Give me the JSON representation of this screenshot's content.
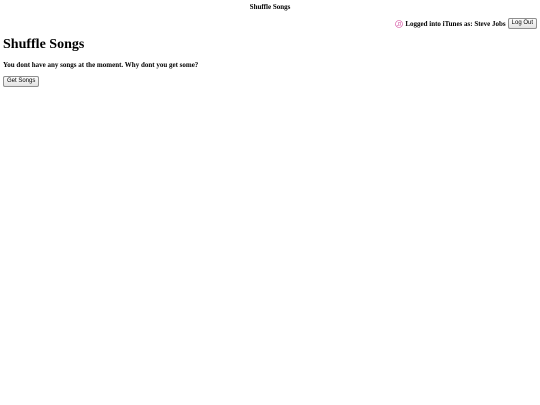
{
  "window": {
    "title": "Shuffle Songs"
  },
  "login": {
    "icon": "itunes-note-icon",
    "status_text": "Logged into iTunes as: Steve Jobs",
    "logout_label": "Log Out"
  },
  "main": {
    "heading": "Shuffle Songs",
    "empty_message": "You dont have any songs at the moment. Why dont you get some?",
    "get_songs_label": "Get Songs"
  },
  "colors": {
    "icon_accent": "#d2459b"
  }
}
